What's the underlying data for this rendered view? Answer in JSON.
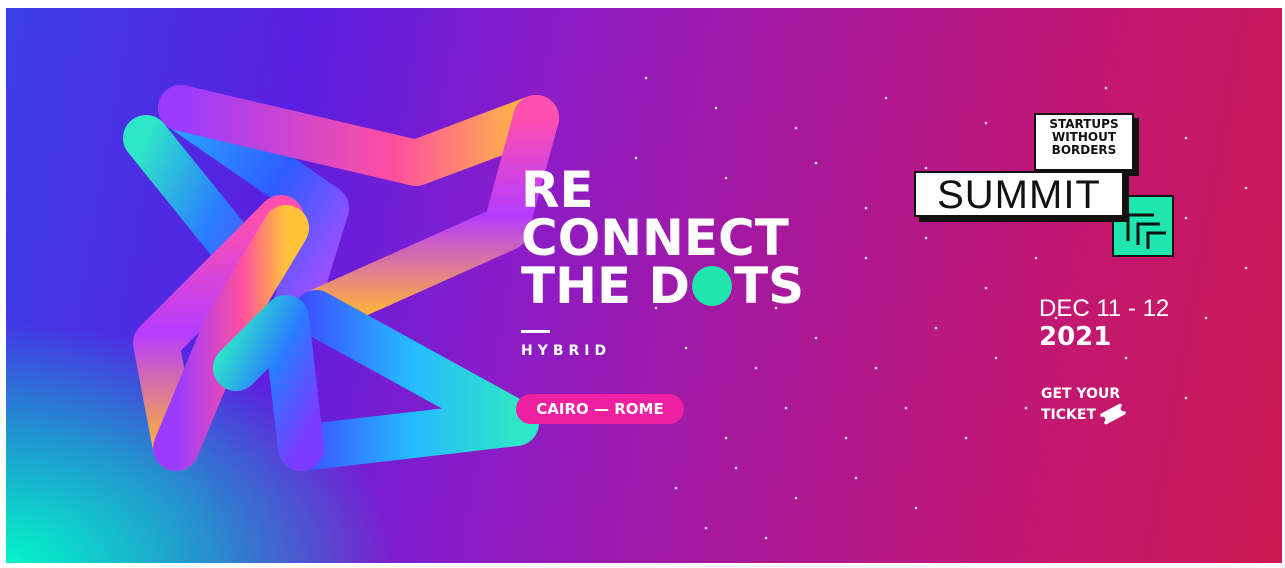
{
  "banner": {
    "headline": {
      "line1": "RE",
      "line2": "CONNECT",
      "line3_a": "THE D",
      "line3_b": "TS"
    },
    "subtitle": "HYBRID",
    "location_pill": "CAIRO — ROME",
    "logo": {
      "line1": "STARTUPS",
      "line2": "WITHOUT",
      "line3": "BORDERS",
      "summit": "SUMMIT"
    },
    "date": "DEC 11 - 12",
    "year": "2021",
    "cta": {
      "line1": "GET YOUR",
      "line2": "TICKET"
    }
  },
  "colors": {
    "accent_teal": "#1ee6ae",
    "pill_pink": "#ee1fa0",
    "bg_left": "#3b3fe6",
    "bg_right": "#cc1a52"
  },
  "icons": {
    "knot": "abstract-knot-star-graphic",
    "ticket": "ticket-icon",
    "logo_arrows": "corner-arrows-icon"
  }
}
